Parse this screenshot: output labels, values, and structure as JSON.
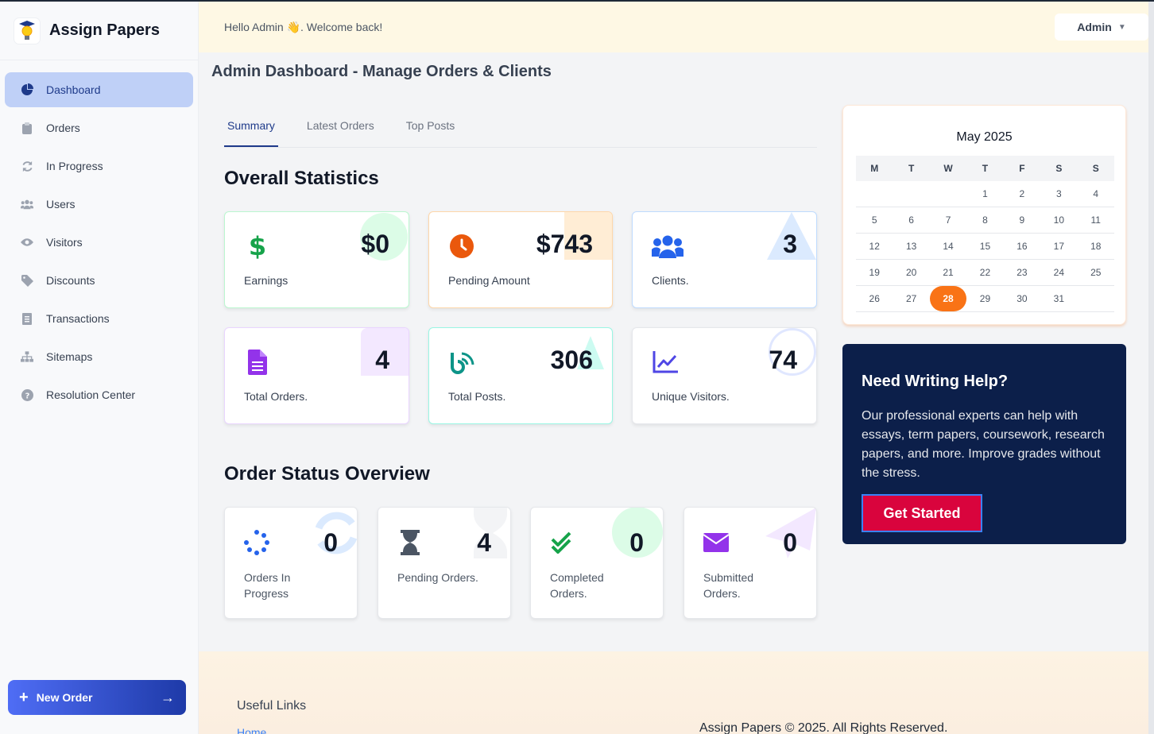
{
  "brand": {
    "name": "Assign Papers"
  },
  "sidebar": {
    "items": [
      {
        "label": "Dashboard",
        "icon": "pie-chart-icon",
        "active": true
      },
      {
        "label": "Orders",
        "icon": "clipboard-icon"
      },
      {
        "label": "In Progress",
        "icon": "refresh-icon"
      },
      {
        "label": "Users",
        "icon": "users-icon"
      },
      {
        "label": "Visitors",
        "icon": "eye-icon"
      },
      {
        "label": "Discounts",
        "icon": "tag-icon"
      },
      {
        "label": "Transactions",
        "icon": "receipt-icon"
      },
      {
        "label": "Sitemaps",
        "icon": "sitemap-icon"
      },
      {
        "label": "Resolution Center",
        "icon": "question-icon"
      }
    ],
    "new_order_label": "New Order"
  },
  "header": {
    "greeting": "Hello Admin 👋. Welcome back!",
    "user_menu": "Admin"
  },
  "page_title": "Admin Dashboard - Manage Orders & Clients",
  "tabs": [
    {
      "label": "Summary",
      "active": true
    },
    {
      "label": "Latest Orders"
    },
    {
      "label": "Top Posts"
    }
  ],
  "overall": {
    "title": "Overall Statistics",
    "cards": [
      {
        "value": "$0",
        "label": "Earnings",
        "icon": "dollar-icon",
        "color": "#16a34a"
      },
      {
        "value": "$743",
        "label": "Pending Amount",
        "icon": "clock-icon",
        "color": "#ea580c"
      },
      {
        "value": "3",
        "label": "Clients.",
        "icon": "users-icon",
        "color": "#2563eb"
      },
      {
        "value": "4",
        "label": "Total Orders.",
        "icon": "document-icon",
        "color": "#9333ea"
      },
      {
        "value": "306",
        "label": "Total Posts.",
        "icon": "blog-icon",
        "color": "#0d9488"
      },
      {
        "value": "74",
        "label": "Unique Visitors.",
        "icon": "chart-line-icon",
        "color": "#4f46e5"
      }
    ]
  },
  "order_status": {
    "title": "Order Status Overview",
    "cards": [
      {
        "value": "0",
        "label": "Orders In Progress",
        "icon": "spinner-icon",
        "color": "#2563eb"
      },
      {
        "value": "4",
        "label": "Pending Orders.",
        "icon": "hourglass-icon",
        "color": "#4b5563"
      },
      {
        "value": "0",
        "label": "Completed Orders.",
        "icon": "double-check-icon",
        "color": "#16a34a"
      },
      {
        "value": "0",
        "label": "Submitted Orders.",
        "icon": "envelope-icon",
        "color": "#9333ea"
      }
    ]
  },
  "calendar": {
    "month": "May 2025",
    "weekdays": [
      "M",
      "T",
      "W",
      "T",
      "F",
      "S",
      "S"
    ],
    "weeks": [
      [
        "",
        "",
        "",
        "1",
        "2",
        "3",
        "4"
      ],
      [
        "5",
        "6",
        "7",
        "8",
        "9",
        "10",
        "11"
      ],
      [
        "12",
        "13",
        "14",
        "15",
        "16",
        "17",
        "18"
      ],
      [
        "19",
        "20",
        "21",
        "22",
        "23",
        "24",
        "25"
      ],
      [
        "26",
        "27",
        "28",
        "29",
        "30",
        "31",
        ""
      ]
    ],
    "today": "28"
  },
  "help": {
    "title": "Need Writing Help?",
    "text": "Our professional experts can help with essays, term papers, coursework, research papers, and more. Improve grades without the stress.",
    "cta": "Get Started"
  },
  "footer": {
    "links_title": "Useful Links",
    "home": "Home",
    "copyright": "Assign Papers © 2025. All Rights Reserved."
  }
}
